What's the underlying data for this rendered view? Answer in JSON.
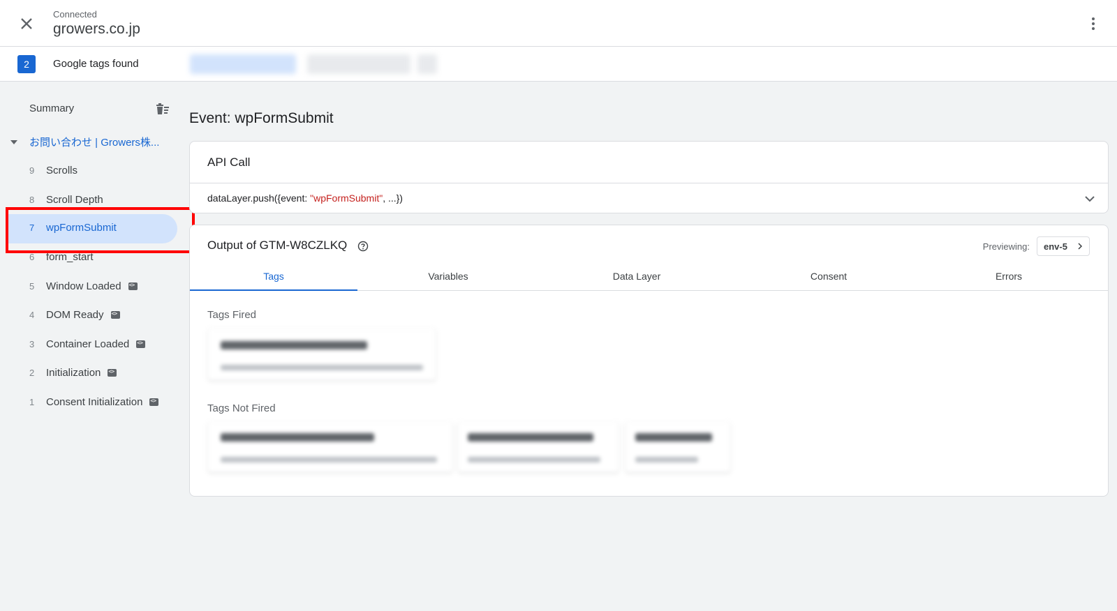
{
  "header": {
    "status": "Connected",
    "domain": "growers.co.jp"
  },
  "tagbar": {
    "count": "2",
    "label": "Google tags found"
  },
  "sidebar": {
    "summary_label": "Summary",
    "page_label": "お問い合わせ | Growers株...",
    "events": [
      {
        "num": "9",
        "name": "Scrolls"
      },
      {
        "num": "8",
        "name": "Scroll Depth"
      },
      {
        "num": "7",
        "name": "wpFormSubmit"
      },
      {
        "num": "6",
        "name": "form_start"
      },
      {
        "num": "5",
        "name": "Window Loaded"
      },
      {
        "num": "4",
        "name": "DOM Ready"
      },
      {
        "num": "3",
        "name": "Container Loaded"
      },
      {
        "num": "2",
        "name": "Initialization"
      },
      {
        "num": "1",
        "name": "Consent Initialization"
      }
    ],
    "active_event": "wpFormSubmit"
  },
  "main": {
    "event_title": "Event: wpFormSubmit",
    "api_call": {
      "title": "API Call",
      "code_prefix": "dataLayer.push({event: ",
      "code_string": "\"wpFormSubmit\"",
      "code_suffix": ", ...})"
    },
    "output": {
      "title": "Output of GTM-W8CZLKQ",
      "previewing_label": "Previewing:",
      "env": "env-5",
      "tabs": [
        "Tags",
        "Variables",
        "Data Layer",
        "Consent",
        "Errors"
      ],
      "active_tab": "Tags",
      "tags_fired_label": "Tags Fired",
      "tags_not_fired_label": "Tags Not Fired"
    }
  },
  "colors": {
    "accent": "#1967d2",
    "active_bg": "#d2e3fc",
    "highlight": "#ff0000",
    "string": "#c5221f"
  }
}
